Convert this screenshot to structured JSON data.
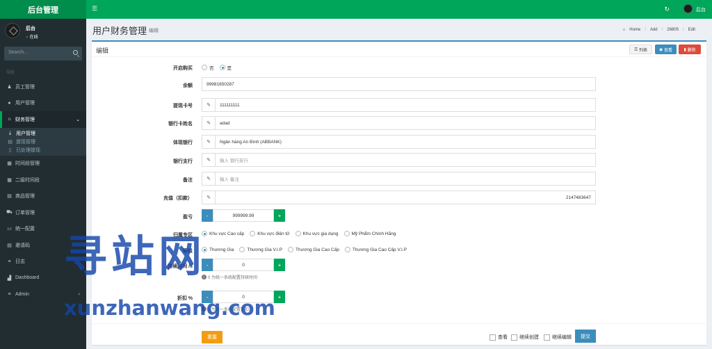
{
  "app": {
    "title": "后台管理"
  },
  "topbar": {
    "menu_icon": "hamburger-icon",
    "refresh_icon": "refresh-icon",
    "user": "后台"
  },
  "sidebar": {
    "user_name": "后台",
    "user_status": "在线",
    "search_placeholder": "Search...",
    "section": "导航",
    "items": [
      {
        "label": "员工管理",
        "icon": "user-tie-icon"
      },
      {
        "label": "用户管理",
        "icon": "user-icon"
      },
      {
        "label": "财务管理",
        "icon": "bank-icon",
        "active": true
      },
      {
        "label": "时间段管理",
        "icon": "calendar-icon"
      },
      {
        "label": "二级时间段",
        "icon": "calendar-icon"
      },
      {
        "label": "商品管理",
        "icon": "table-icon"
      },
      {
        "label": "订单管理",
        "icon": "cart-icon"
      },
      {
        "label": "统一配置",
        "icon": "monitor-icon"
      },
      {
        "label": "邀请码",
        "icon": "table-icon"
      },
      {
        "label": "日志",
        "icon": "list-icon"
      },
      {
        "label": "Dashboard",
        "icon": "chart-icon"
      },
      {
        "label": "Admin",
        "icon": "list-icon"
      }
    ],
    "submenu": [
      {
        "label": "用户管理",
        "icon": "download-icon",
        "active": true
      },
      {
        "label": "提现管理",
        "icon": "table-icon"
      },
      {
        "label": "已处理提现",
        "icon": "file-icon"
      }
    ]
  },
  "header": {
    "title": "用户财务管理",
    "subtitle": "编辑",
    "breadcrumb": [
      "Home",
      "Add",
      "26805",
      "Edit"
    ]
  },
  "box": {
    "title": "编辑",
    "btn_list": "列表",
    "btn_view": "查看",
    "btn_delete": "删除"
  },
  "form": {
    "buy_label": "开启购买",
    "buy_options": [
      "否",
      "是"
    ],
    "buy_selected": "是",
    "balance_label": "余额",
    "balance_value": "99981650287",
    "card_label": "提现卡号",
    "card_value": "111111111",
    "card_name_label": "银行卡姓名",
    "card_name_value": "adad",
    "bank_label": "体现银行",
    "bank_value": "Ngân hàng An Bình (ABBANK)",
    "branch_label": "银行支行",
    "branch_placeholder": "输入 银行支行",
    "note_label": "备注",
    "note_placeholder": "输入 备注",
    "recharge_label": "充值（扣款）",
    "recharge_value": "2147483647",
    "profit_label": "盈亏",
    "profit_value": "999999.99",
    "zone_label": "归属专区",
    "zones": [
      "Khu vực Cao cấp",
      "Khu vực điện tử",
      "Khu vực gia dụng",
      "Mỹ Phẩm Chính Hãng"
    ],
    "zone_selected": "Khu vực Cao cấp",
    "level_label": "等级",
    "levels": [
      "Thương Gia",
      "Thương Gia V.I.P",
      "Thương Gia Cao Cấp",
      "Thương Gia Cao Cấp V.I.P"
    ],
    "level_selected": "Thương Gia",
    "duration_label": "持续时间 /s",
    "duration_value": "0",
    "duration_help": "0 为统一系统配置持续时间",
    "discount_label": "折扣 %",
    "discount_value": "0",
    "discount_help": "0 为统一系统配置折扣",
    "minus": "-",
    "plus": "+"
  },
  "footer": {
    "reset": "重置",
    "check_view": "查看",
    "check_continue_create": "继续创建",
    "check_continue_edit": "继续编辑",
    "submit": "提交"
  },
  "watermark": {
    "text": "寻站网",
    "url": "xunzhanwang.com"
  },
  "colors": {
    "green": "#00a65a",
    "dark_green": "#008d4c",
    "sidebar": "#222d32",
    "blue": "#3c8dbc",
    "red": "#dd4b39",
    "orange": "#f39c12"
  }
}
